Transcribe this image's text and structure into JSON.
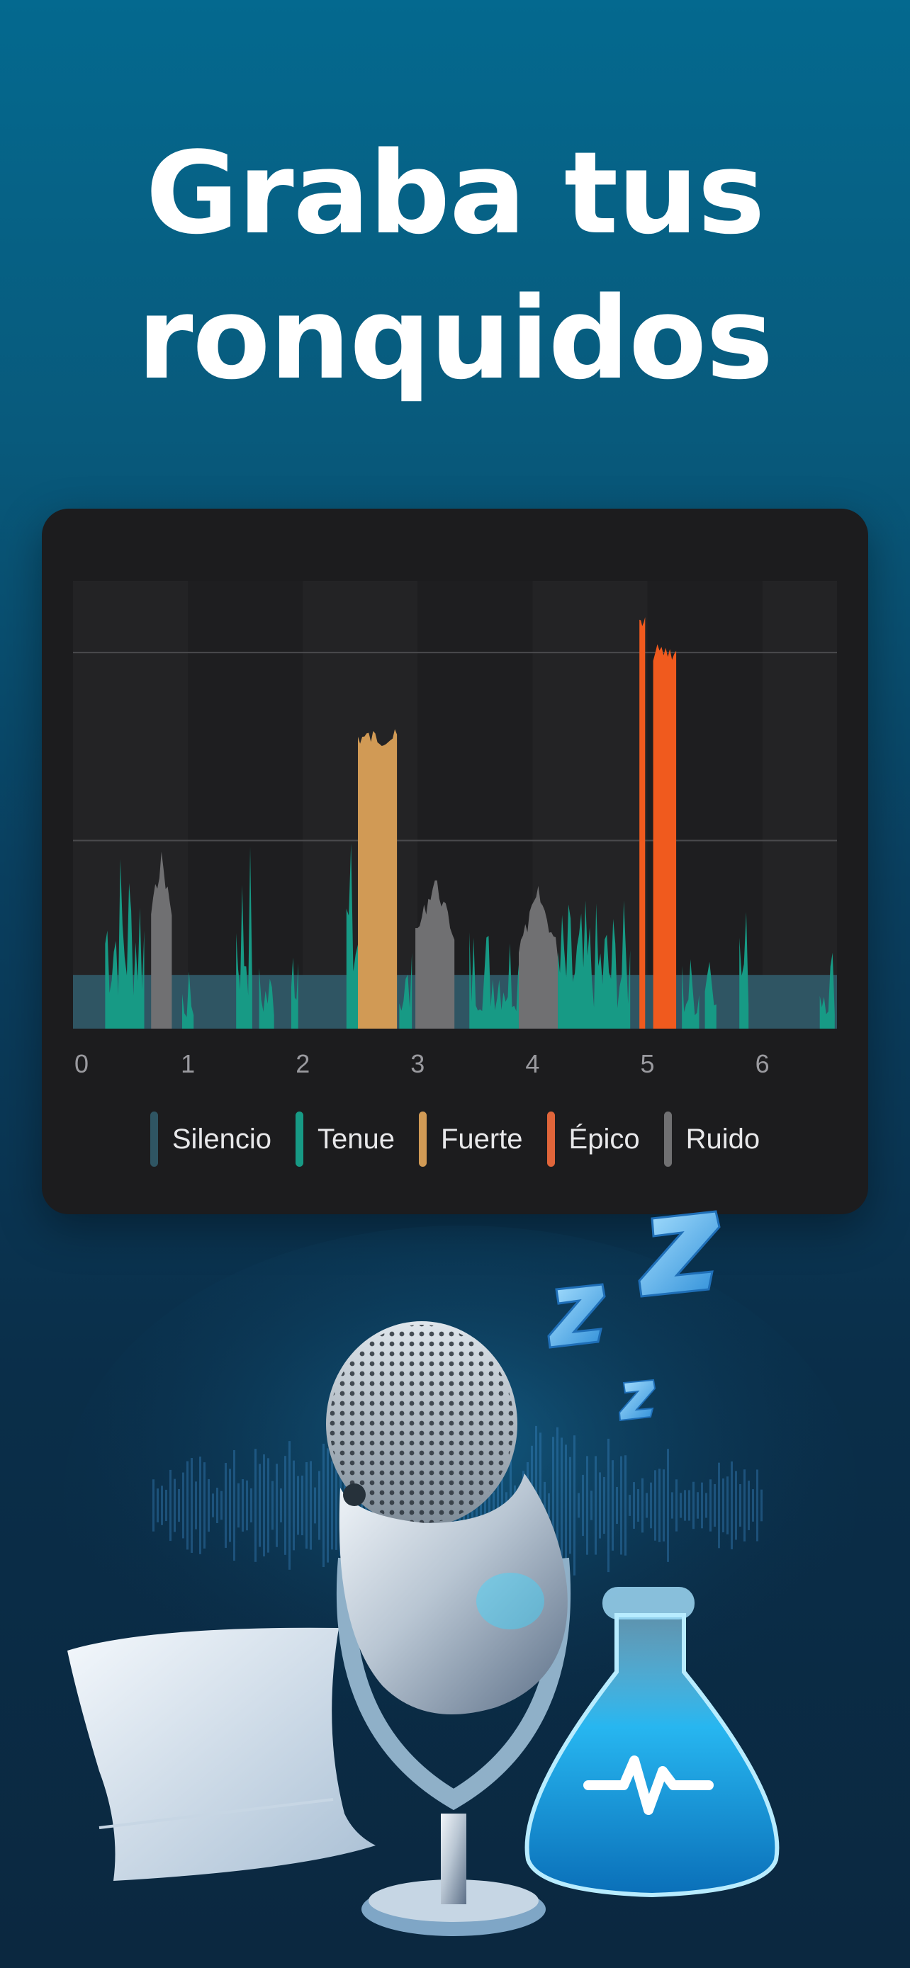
{
  "headline": {
    "line1": "Graba tus",
    "line2": "ronquidos"
  },
  "colors": {
    "silencio": "#2f5563",
    "tenue": "#179a85",
    "fuerte": "#d19a55",
    "epico": "#f05a1e",
    "ruido": "#707072",
    "card": "#1c1c1e"
  },
  "legend": [
    {
      "key": "silencio",
      "label": "Silencio",
      "color": "#2f5563"
    },
    {
      "key": "tenue",
      "label": "Tenue",
      "color": "#179a85"
    },
    {
      "key": "fuerte",
      "label": "Fuerte",
      "color": "#d19a55"
    },
    {
      "key": "epico",
      "label": "Épico",
      "color": "#e0653a"
    },
    {
      "key": "ruido",
      "label": "Ruido",
      "color": "#707072"
    }
  ],
  "chart_data": {
    "type": "bar",
    "xlim": [
      0,
      6.65
    ],
    "ylim": [
      0,
      1
    ],
    "x_ticks": [
      "0",
      "1",
      "2",
      "3",
      "4",
      "5",
      "6"
    ],
    "gridlines_y": [
      0.42,
      0.84
    ],
    "silence_level": 0.12,
    "legend_position": "bottom",
    "segments": [
      {
        "category": "tenue",
        "x0": 0.28,
        "x1": 0.62,
        "peak": 0.45
      },
      {
        "category": "ruido",
        "x0": 0.68,
        "x1": 0.86,
        "peak": 0.4
      },
      {
        "category": "tenue",
        "x0": 0.95,
        "x1": 1.05,
        "peak": 0.13
      },
      {
        "category": "tenue",
        "x0": 1.42,
        "x1": 1.56,
        "peak": 0.45
      },
      {
        "category": "tenue",
        "x0": 1.62,
        "x1": 1.75,
        "peak": 0.16
      },
      {
        "category": "tenue",
        "x0": 1.9,
        "x1": 1.96,
        "peak": 0.41
      },
      {
        "category": "tenue",
        "x0": 2.38,
        "x1": 2.48,
        "peak": 0.44
      },
      {
        "category": "fuerte",
        "x0": 2.48,
        "x1": 2.82,
        "peak": 0.67
      },
      {
        "category": "tenue",
        "x0": 2.84,
        "x1": 2.95,
        "peak": 0.18
      },
      {
        "category": "ruido",
        "x0": 2.98,
        "x1": 3.32,
        "peak": 0.35
      },
      {
        "category": "tenue",
        "x0": 3.45,
        "x1": 4.1,
        "peak": 0.26
      },
      {
        "category": "ruido",
        "x0": 3.88,
        "x1": 4.22,
        "peak": 0.32
      },
      {
        "category": "tenue",
        "x0": 4.22,
        "x1": 4.85,
        "peak": 0.29
      },
      {
        "category": "epico",
        "x0": 4.93,
        "x1": 4.98,
        "peak": 0.92
      },
      {
        "category": "epico",
        "x0": 5.05,
        "x1": 5.25,
        "peak": 0.86
      },
      {
        "category": "tenue",
        "x0": 5.3,
        "x1": 5.45,
        "peak": 0.18
      },
      {
        "category": "tenue",
        "x0": 5.5,
        "x1": 5.6,
        "peak": 0.34
      },
      {
        "category": "tenue",
        "x0": 5.8,
        "x1": 5.88,
        "peak": 0.3
      },
      {
        "category": "tenue",
        "x0": 6.5,
        "x1": 6.63,
        "peak": 0.21
      }
    ]
  }
}
